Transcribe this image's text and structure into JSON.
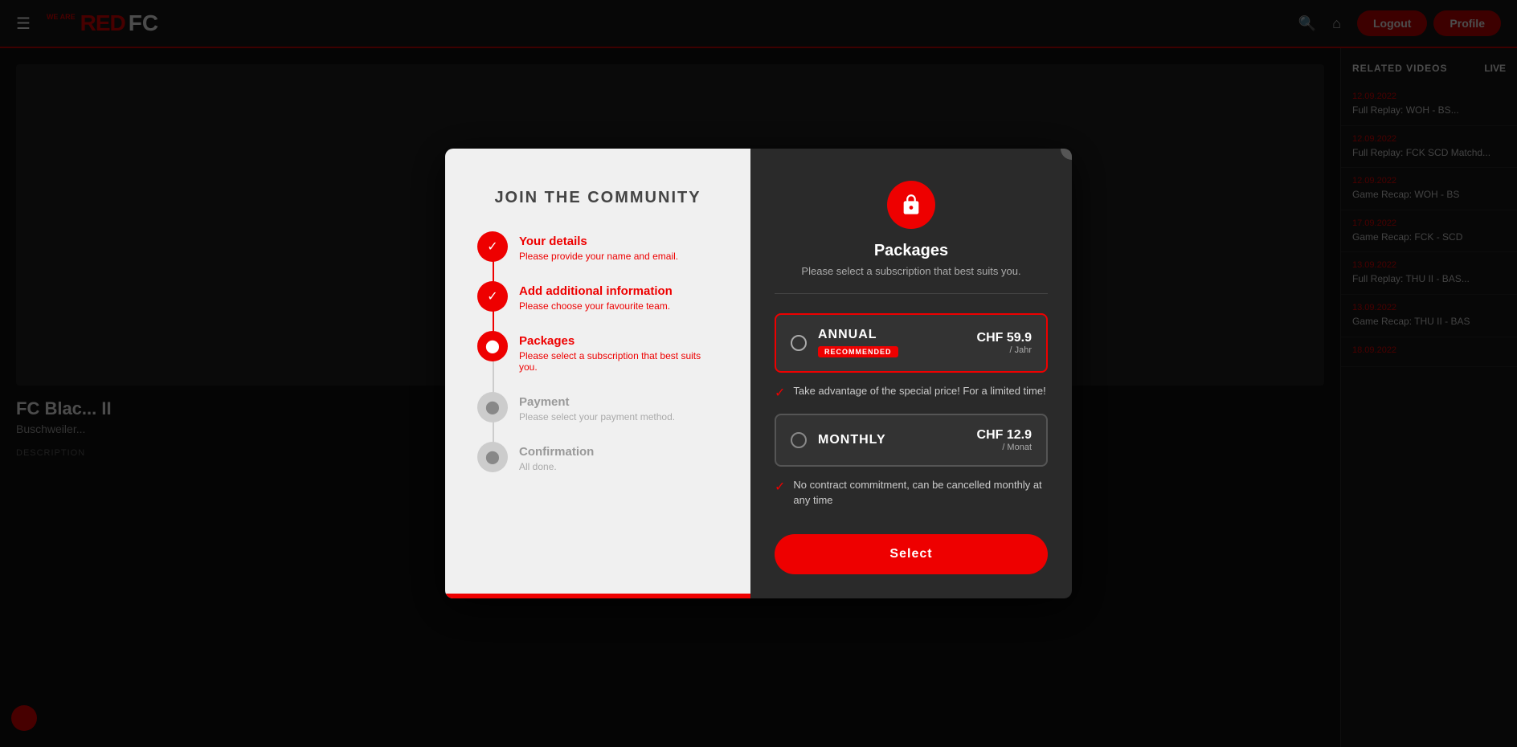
{
  "app": {
    "logo_prefix": "WE ARE",
    "logo_red": "RED",
    "logo_fc": "FC"
  },
  "navbar": {
    "logout_label": "Logout",
    "profile_label": "Profile"
  },
  "sidebar": {
    "related_videos": "RELATED VIDEOS",
    "live": "LIVE",
    "items": [
      {
        "date": "12.09.2022",
        "title": "Full Replay: WOH - BS..."
      },
      {
        "date": "12.09.2022",
        "title": "Full Replay: FCK SCD Matchd..."
      },
      {
        "date": "12.09.2022",
        "title": "Game Recap: WOH - BS"
      },
      {
        "date": "17.09.2022",
        "title": "Game Recap: FCK - SCD"
      },
      {
        "date": "13.09.2022",
        "title": "Full Replay: THU II - BAS..."
      },
      {
        "date": "13.09.2022",
        "title": "Game Recap: THU II - BAS"
      },
      {
        "date": "18.09.2022",
        "title": ""
      }
    ]
  },
  "video": {
    "title": "FC Blac... II",
    "subtitle": "Buschweiler...",
    "description_label": "DESCRIPTION"
  },
  "modal": {
    "close_label": "×",
    "left": {
      "title": "JOIN THE COMMUNITY",
      "steps": [
        {
          "state": "done",
          "title": "Your details",
          "desc": "Please provide your name and email."
        },
        {
          "state": "done",
          "title": "Add additional information",
          "desc": "Please choose your favourite team."
        },
        {
          "state": "active",
          "title": "Packages",
          "desc": "Please select a subscription that best suits you."
        },
        {
          "state": "inactive",
          "title": "Payment",
          "desc": "Please select your payment method."
        },
        {
          "state": "inactive",
          "title": "Confirmation",
          "desc": "All done."
        }
      ]
    },
    "right": {
      "icon": "🔒",
      "title": "Packages",
      "subtitle": "Please select a subscription that best suits you.",
      "plans": [
        {
          "id": "annual",
          "name": "ANNUAL",
          "badge": "RECOMMENDED",
          "price": "CHF 59.9",
          "period": "/ Jahr",
          "selected": true,
          "feature": "Take advantage of the special price! For a limited time!"
        },
        {
          "id": "monthly",
          "name": "MONTHLY",
          "badge": "",
          "price": "CHF 12.9",
          "period": "/ Monat",
          "selected": false,
          "feature": "No contract commitment, can be cancelled monthly at any time"
        }
      ],
      "select_label": "Select"
    }
  }
}
